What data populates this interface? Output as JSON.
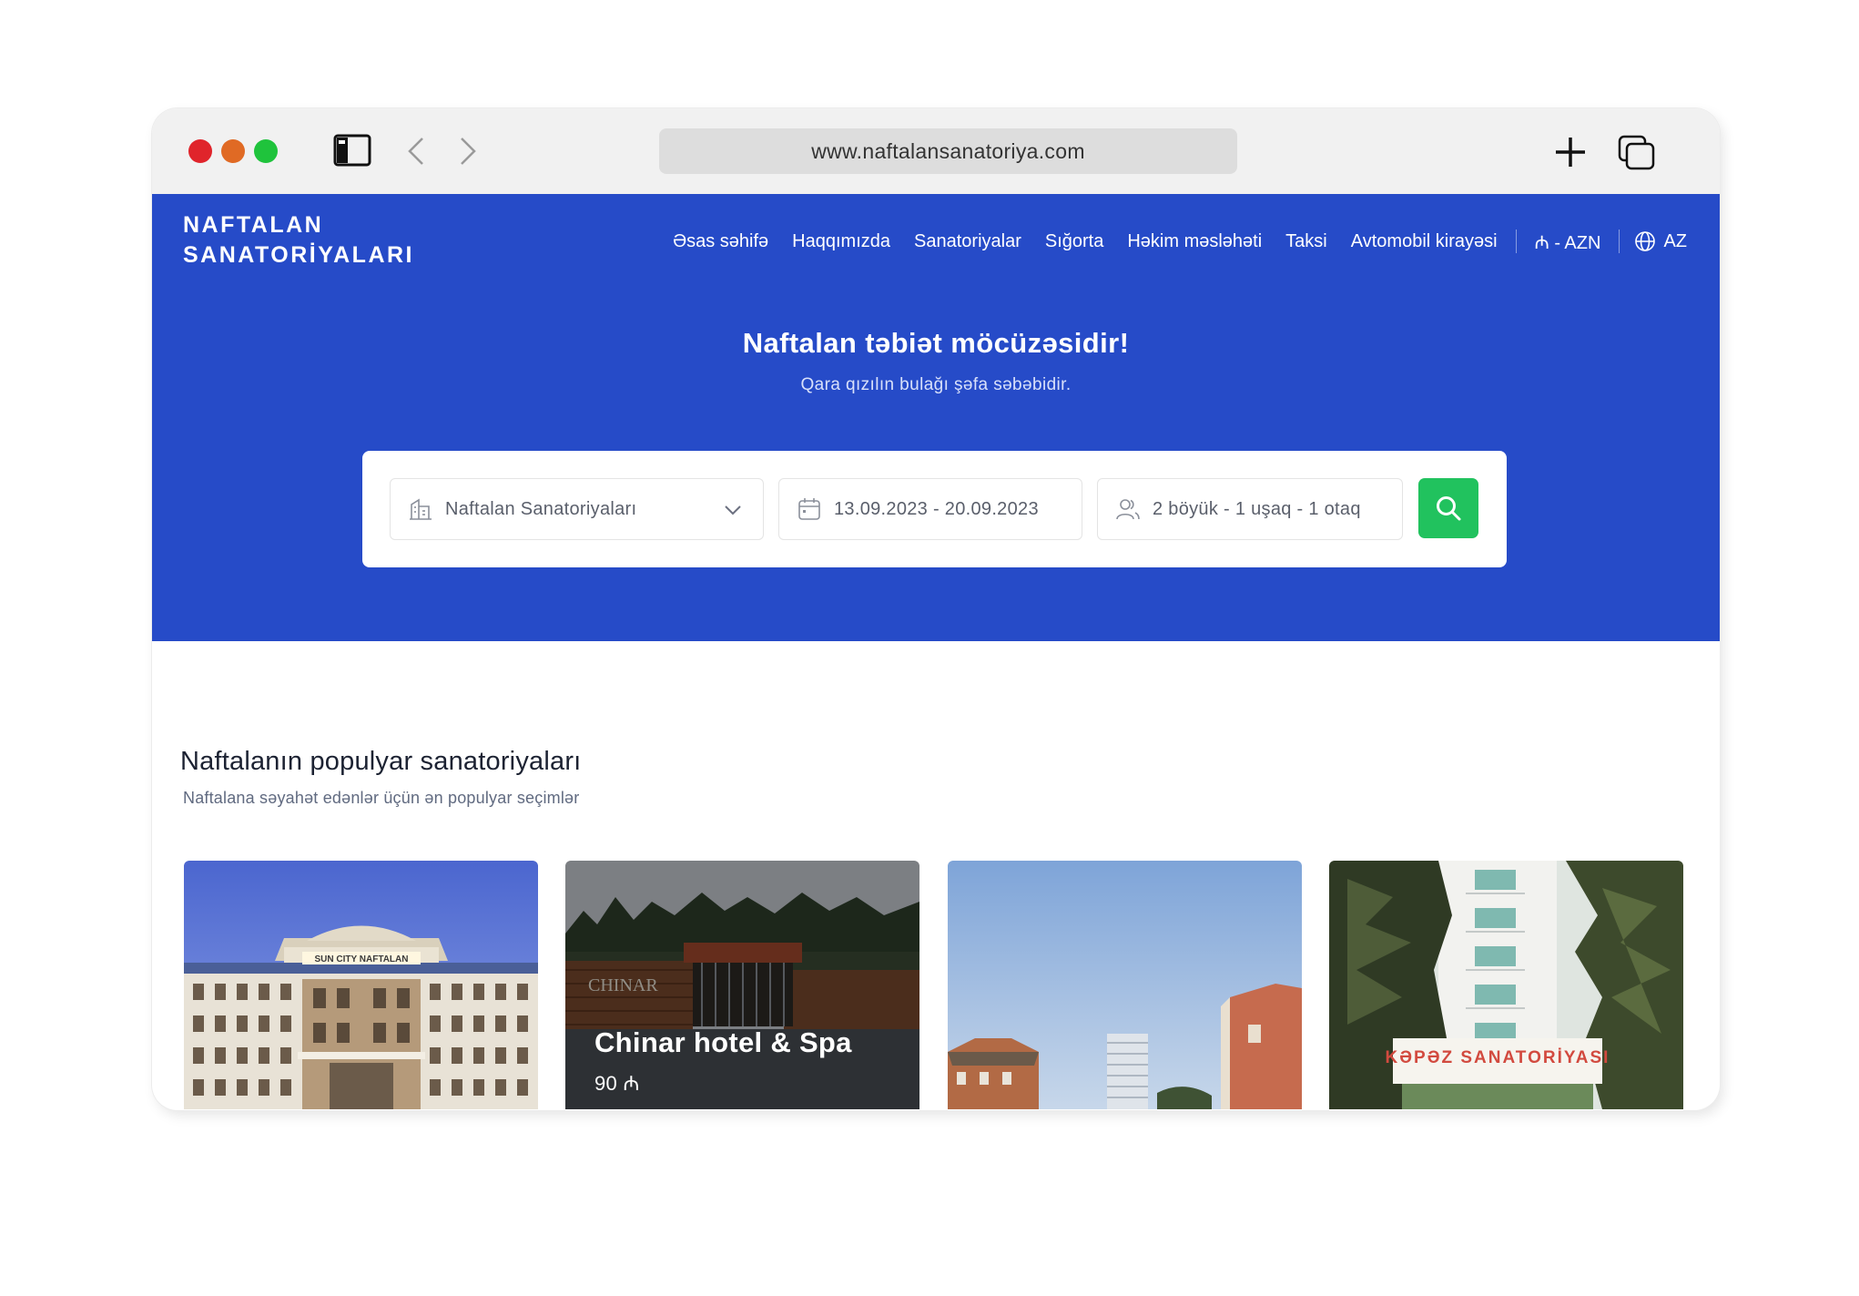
{
  "browser": {
    "url": "www.naftalansanatoriya.com",
    "traffic_lights": [
      "#e0242b",
      "#e06a24",
      "#1fc33c"
    ]
  },
  "site": {
    "logo_line1": "NAFTALAN",
    "logo_line2": "SANATORİYALARI",
    "nav": [
      {
        "label": "Əsas səhifə"
      },
      {
        "label": "Haqqımızda"
      },
      {
        "label": "Sanatoriyalar"
      },
      {
        "label": "Sığorta"
      },
      {
        "label": "Həkim məsləhəti"
      },
      {
        "label": "Taksi"
      },
      {
        "label": "Avtomobil kirayəsi"
      }
    ],
    "currency": "₼ - AZN",
    "language": "AZ",
    "brand_color": "#264bc8",
    "accent_color": "#21c25e"
  },
  "hero": {
    "title": "Naftalan təbiət möcüzəsidir!",
    "subtitle": "Qara qızılın bulağı şəfa səbəbidir."
  },
  "search": {
    "location": "Naftalan Sanatoriyaları",
    "dates": "13.09.2023 - 20.09.2023",
    "guests": "2 böyük - 1 uşaq - 1 otaq"
  },
  "popular": {
    "title": "Naftalanın populyar sanatoriyaları",
    "subtitle": "Naftalana səyahət edənlər üçün ən populyar seçimlər",
    "cards": [
      {
        "image": "sun-city-building",
        "sign": "SUN CITY NAFTALAN"
      },
      {
        "image": "chinar-gate",
        "name": "Chinar hotel & Spa",
        "price": "90 ₼",
        "sign": "CHINAR"
      },
      {
        "image": "sky-buildings"
      },
      {
        "image": "kepez-tower",
        "sign": "KƏPƏZ SANATORİYASI"
      }
    ]
  }
}
